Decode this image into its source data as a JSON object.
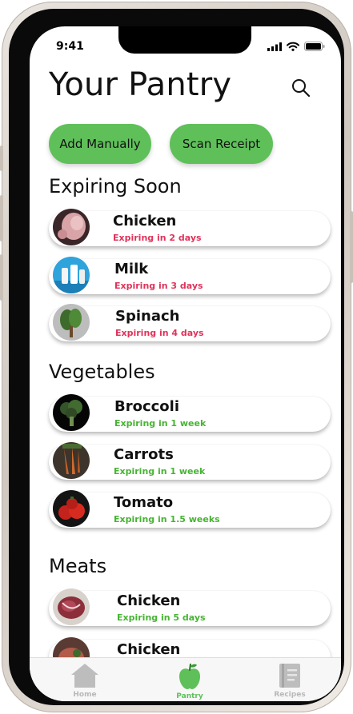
{
  "status": {
    "time": "9:41"
  },
  "header": {
    "title": "Your Pantry"
  },
  "actions": {
    "add_manually": "Add Manually",
    "scan_receipt": "Scan Receipt"
  },
  "sections": {
    "expiring": {
      "title": "Expiring Soon",
      "items": [
        {
          "name": "Chicken",
          "expiry": "Expiring in 2 days"
        },
        {
          "name": "Milk",
          "expiry": "Expiring in 3 days"
        },
        {
          "name": "Spinach",
          "expiry": "Expiring in 4 days"
        }
      ]
    },
    "vegetables": {
      "title": "Vegetables",
      "items": [
        {
          "name": "Broccoli",
          "expiry": "Expiring in 1 week"
        },
        {
          "name": "Carrots",
          "expiry": "Expiring in 1 week"
        },
        {
          "name": "Tomato",
          "expiry": "Expiring in 1.5 weeks"
        }
      ]
    },
    "meats": {
      "title": "Meats",
      "items": [
        {
          "name": "Chicken",
          "expiry": "Expiring in 5 days"
        },
        {
          "name": "Chicken"
        }
      ]
    }
  },
  "tabbar": {
    "items": [
      {
        "label": "Home",
        "icon": "home-icon"
      },
      {
        "label": "Pantry",
        "icon": "apple-icon"
      },
      {
        "label": "Recipes",
        "icon": "book-icon"
      }
    ],
    "active": "Pantry"
  },
  "colors": {
    "accent": "#5fc05a",
    "expiring_soon": "#e0335a",
    "fresh": "#46b432",
    "tab_inactive": "#b8b8b8"
  }
}
